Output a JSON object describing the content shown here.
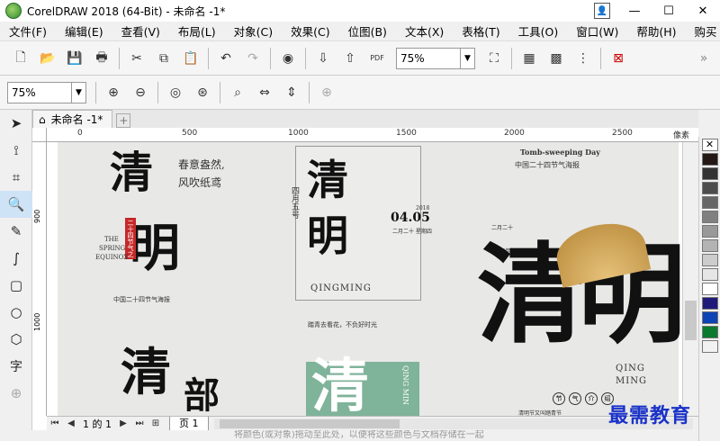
{
  "window": {
    "title": "CorelDRAW 2018 (64-Bit) - 未命名 -1*",
    "minimize": "—",
    "maximize": "☐",
    "close": "✕"
  },
  "menu": [
    "文件(F)",
    "编辑(E)",
    "查看(V)",
    "布局(L)",
    "对象(C)",
    "效果(C)",
    "位图(B)",
    "文本(X)",
    "表格(T)",
    "工具(O)",
    "窗口(W)",
    "帮助(H)",
    "购买"
  ],
  "toolbar": {
    "zoom_value": "75%",
    "pdf_label": "PDF"
  },
  "propbar": {
    "zoom_value": "75%"
  },
  "doc": {
    "tab_label": "未命名 -1*"
  },
  "ruler": {
    "h_labels": [
      "0",
      "500",
      "1000",
      "1500",
      "2000",
      "2500"
    ],
    "h_unit": "像素",
    "v_labels": [
      "900",
      "1000"
    ]
  },
  "status": {
    "page_info": "1 的 1",
    "page_tab": "页 1"
  },
  "hint": "将颜色(或对象)拖动至此处，以便将这些颜色与文档存储在一起",
  "watermark": "最需教育",
  "artwork": {
    "poster1": {
      "big1": "清",
      "big2": "明",
      "slogan1": "春意盎然,",
      "slogan2": "风吹纸鸢",
      "sub1": "THE",
      "sub2": "SPRING",
      "sub3": "EQUINOX",
      "seal": "二十四节气之",
      "footer": "中国二十四节气海报"
    },
    "poster2": {
      "big1": "清",
      "big2": "明",
      "date_label": "四月五号",
      "date": "04.05",
      "year": "2018",
      "solar": "二月二十 星期四",
      "english": "QINGMING",
      "caption": "踏青去看花，不负好时光"
    },
    "poster3": {
      "headline": "Tomb-sweeping Day",
      "subhead": "中国二十四节气海报",
      "big": "清明",
      "english1": "QING",
      "english2": "MING",
      "tags": [
        "节",
        "气",
        "介",
        "绍"
      ],
      "date": "2018年04月05日",
      "info": "二月二十",
      "footer": "清明节又叫踏青节"
    },
    "poster4": {
      "big": "清",
      "english": "QING MIN"
    },
    "poster5": {
      "big": "清",
      "big2": "部"
    }
  },
  "palette_colors": [
    "#ffffff",
    "#000000",
    "#1a1a1a",
    "#333333",
    "#4d4d4d",
    "#666666",
    "#808080",
    "#999999",
    "#b3b3b3",
    "#cccccc",
    "#e6e6e6",
    "#ffffff",
    "#1f1a7a",
    "#0c43b5",
    "#0a7a2e",
    "#f2f2f2"
  ]
}
